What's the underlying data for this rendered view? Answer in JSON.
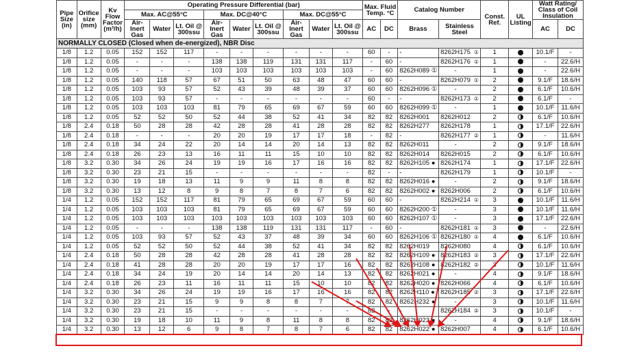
{
  "headers": {
    "pipe_size": "Pipe Size (in)",
    "orifice_size": "Orifice size (mm)",
    "kv_flow": "Kv Flow Factor (m³/h)",
    "opd": "Operating Pressure Differential (bar)",
    "max_ac": "Max. AC@55°C",
    "max_dc40": "Max. DC@40°C",
    "max_dc55": "Max. DC@55°C",
    "air_inert_gas": "Air-Inert Gas",
    "water": "Water",
    "lt_oil": "Lt. Oil @ 300ssu",
    "max_fluid_temp": "Max. Fluid Temp. °C",
    "ac": "AC",
    "dc": "DC",
    "catalog_number": "Catalog Number",
    "brass": "Brass",
    "stainless_steel": "Stainless Steel",
    "const_ref": "Const. Ref.",
    "ul_listing": "UL Listing",
    "watt_rating": "Watt Rating/ Class of Coil Insulation"
  },
  "section_title": "NORMALLY CLOSED (Closed when de-energized), NBR Disc",
  "highlight_color": "#e01818",
  "rows": [
    [
      "1/8",
      "1.2",
      "0.05",
      "152",
      "152",
      "117",
      "-",
      "-",
      "-",
      "-",
      "-",
      "-",
      "60",
      "-",
      "-",
      "8262H175",
      "①",
      "1",
      "full",
      "10.1/F",
      "-"
    ],
    [
      "1/8",
      "1.2",
      "0.05",
      "-",
      "-",
      "-",
      "138",
      "138",
      "119",
      "131",
      "131",
      "117",
      "-",
      "60",
      "-",
      "8262H176",
      "①",
      "1",
      "full",
      "-",
      "22.6/H"
    ],
    [
      "1/8",
      "1.2",
      "0.05",
      "-",
      "-",
      "-",
      "103",
      "103",
      "103",
      "103",
      "103",
      "103",
      "-",
      "60",
      "8262H089 ①",
      "-",
      "",
      "1",
      "full",
      "-",
      "22.6/H"
    ],
    [
      "1/8",
      "1.2",
      "0.05",
      "140",
      "118",
      "57",
      "67",
      "51",
      "50",
      "63",
      "48",
      "47",
      "60",
      "60",
      "-",
      "8262H079",
      "①",
      "2",
      "full",
      "9.1/F",
      "18.6/H"
    ],
    [
      "1/8",
      "1.2",
      "0.05",
      "103",
      "93",
      "57",
      "52",
      "43",
      "39",
      "48",
      "39",
      "37",
      "60",
      "60",
      "8262H096 ①",
      "-",
      "",
      "2",
      "full",
      "6.1/F",
      "10.6/H"
    ],
    [
      "1/8",
      "1.2",
      "0.05",
      "103",
      "93",
      "57",
      "-",
      "-",
      "-",
      "-",
      "-",
      "-",
      "60",
      "-",
      "-",
      "8262H173",
      "①",
      "2",
      "full",
      "6.1/F",
      "-"
    ],
    [
      "1/8",
      "1.2",
      "0.05",
      "103",
      "103",
      "103",
      "81",
      "79",
      "65",
      "69",
      "67",
      "59",
      "60",
      "60",
      "8262H099 ①",
      "-",
      "",
      "1",
      "full",
      "10.1/F",
      "11.6/H"
    ],
    [
      "1/8",
      "1.2",
      "0.05",
      "52",
      "52",
      "50",
      "52",
      "44",
      "38",
      "52",
      "41",
      "34",
      "82",
      "82",
      "8262H001",
      "8262H012",
      "",
      "2",
      "half",
      "6.1/F",
      "10.6/H"
    ],
    [
      "1/8",
      "2.4",
      "0.18",
      "50",
      "28",
      "28",
      "42",
      "28",
      "28",
      "41",
      "28",
      "28",
      "82",
      "82",
      "8262H277",
      "8262H178",
      "",
      "1",
      "half",
      "17.1/F",
      "22.6/H"
    ],
    [
      "1/8",
      "2.4",
      "0.18",
      "-",
      "-",
      "-",
      "20",
      "20",
      "19",
      "17",
      "17",
      "18",
      "-",
      "82",
      "-",
      "8262H177",
      "②",
      "1",
      "half",
      "-",
      "11.6/H"
    ],
    [
      "1/8",
      "2.4",
      "0.18",
      "34",
      "24",
      "22",
      "20",
      "14",
      "14",
      "20",
      "14",
      "13",
      "82",
      "82",
      "8262H011",
      "-",
      "",
      "2",
      "half",
      "9.1/F",
      "18.6/H"
    ],
    [
      "1/8",
      "2.4",
      "0.18",
      "26",
      "23",
      "13",
      "16",
      "11",
      "11",
      "15",
      "10",
      "10",
      "82",
      "82",
      "8262H014",
      "8262H015",
      "",
      "2",
      "half",
      "6.1/F",
      "10.6/H"
    ],
    [
      "1/8",
      "3.2",
      "0.30",
      "34",
      "26",
      "24",
      "19",
      "19",
      "16",
      "17",
      "16",
      "16",
      "82",
      "82",
      "8262H105 ●",
      "8262H174",
      "",
      "1",
      "half",
      "17.1/F",
      "22.6/H"
    ],
    [
      "1/8",
      "3.2",
      "0.30",
      "23",
      "21",
      "15",
      "-",
      "-",
      "-",
      "-",
      "-",
      "-",
      "82",
      "-",
      "-",
      "8262H179",
      "",
      "1",
      "half",
      "10.1/F",
      "-"
    ],
    [
      "1/8",
      "3.2",
      "0.30",
      "19",
      "18",
      "13",
      "11",
      "9",
      "9",
      "11",
      "8",
      "8",
      "82",
      "82",
      "8262H016 ●",
      "-",
      "",
      "2",
      "half",
      "9.1/F",
      "18.6/H"
    ],
    [
      "1/8",
      "3.2",
      "0.30",
      "13",
      "12",
      "8",
      "9",
      "8",
      "7",
      "8",
      "7",
      "6",
      "82",
      "82",
      "8262H002 ●",
      "8262H006",
      "",
      "2",
      "half",
      "6.1/F",
      "10.6/H"
    ],
    [
      "1/4",
      "1.2",
      "0.05",
      "152",
      "152",
      "117",
      "81",
      "79",
      "65",
      "69",
      "67",
      "59",
      "60",
      "60",
      "-",
      "8262H214",
      "①",
      "3",
      "full",
      "10.1/F",
      "11.6/H"
    ],
    [
      "1/4",
      "1.2",
      "0.05",
      "103",
      "103",
      "103",
      "81",
      "79",
      "65",
      "69",
      "67",
      "59",
      "60",
      "60",
      "8262H200 ①",
      "-",
      "",
      "3",
      "full",
      "10.1/F",
      "11.6/H"
    ],
    [
      "1/4",
      "1.2",
      "0.05",
      "103",
      "103",
      "103",
      "103",
      "103",
      "103",
      "103",
      "103",
      "103",
      "60",
      "60",
      "8262H107 ①",
      "-",
      "",
      "3",
      "full",
      "17.1/F",
      "22.6/H"
    ],
    [
      "1/4",
      "1.2",
      "0.05",
      "-",
      "-",
      "-",
      "138",
      "138",
      "119",
      "131",
      "131",
      "117",
      "-",
      "60",
      "-",
      "8262H181",
      "①",
      "3",
      "full",
      "-",
      "22.6/H"
    ],
    [
      "1/4",
      "1.2",
      "0.05",
      "103",
      "93",
      "57",
      "52",
      "43",
      "37",
      "48",
      "39",
      "34",
      "60",
      "60",
      "8262H106 ①",
      "8262H180",
      "①",
      "4",
      "full",
      "6.1/F",
      "10.6/H"
    ],
    [
      "1/4",
      "1.2",
      "0.05",
      "52",
      "52",
      "50",
      "52",
      "44",
      "38",
      "52",
      "41",
      "34",
      "82",
      "82",
      "8262H019",
      "8262H080",
      "",
      "4",
      "half",
      "6.1/F",
      "10.6/H"
    ],
    [
      "1/4",
      "2.4",
      "0.18",
      "50",
      "28",
      "28",
      "42",
      "28",
      "28",
      "41",
      "28",
      "28",
      "82",
      "82",
      "8262H109 ●",
      "8262H183",
      "②",
      "3",
      "half",
      "17.1/F",
      "22.6/H"
    ],
    [
      "1/4",
      "2.4",
      "0.18",
      "41",
      "28",
      "28",
      "20",
      "20",
      "19",
      "17",
      "17",
      "16",
      "82",
      "82",
      "8262H108 ●",
      "8262H182",
      "②",
      "3",
      "half",
      "10.1/F",
      "11.6/H"
    ],
    [
      "1/4",
      "2.4",
      "0.18",
      "34",
      "24",
      "19",
      "20",
      "14",
      "14",
      "20",
      "14",
      "13",
      "82",
      "82",
      "8262H021 ●",
      "-",
      "",
      "4",
      "half",
      "9.1/F",
      "18.6/H"
    ],
    [
      "1/4",
      "2.4",
      "0.18",
      "26",
      "23",
      "11",
      "16",
      "11",
      "11",
      "15",
      "10",
      "10",
      "82",
      "82",
      "8262H020 ●",
      "8262H066",
      "",
      "4",
      "half",
      "6.1/F",
      "10.6/H"
    ],
    [
      "1/4",
      "3.2",
      "0.30",
      "34",
      "26",
      "24",
      "19",
      "19",
      "16",
      "17",
      "16",
      "16",
      "82",
      "82",
      "8262H110 ●",
      "8262H185",
      "②",
      "3",
      "half",
      "17.1/F",
      "22.6/H"
    ],
    [
      "1/4",
      "3.2",
      "0.30",
      "23",
      "21",
      "15",
      "9",
      "9",
      "8",
      "8",
      "7",
      "7",
      "82",
      "82",
      "8262H232 ●",
      "-",
      "",
      "3",
      "half",
      "10.1/F",
      "11.6/H"
    ],
    [
      "1/4",
      "3.2",
      "0.30",
      "23",
      "21",
      "15",
      "-",
      "-",
      "-",
      "-",
      "-",
      "-",
      "82",
      "-",
      "-",
      "8262H184",
      "②",
      "3",
      "half",
      "10.1/F",
      "-"
    ],
    [
      "1/4",
      "3.2",
      "0.30",
      "19",
      "18",
      "10",
      "11",
      "9",
      "8",
      "11",
      "8",
      "8",
      "82",
      "82",
      "8262H023 ●",
      "-",
      "",
      "4",
      "half",
      "9.1/F",
      "18.6/H"
    ],
    [
      "1/4",
      "3.2",
      "0.30",
      "13",
      "12",
      "6",
      "9",
      "8",
      "7",
      "8",
      "7",
      "6",
      "82",
      "82",
      "8262H022 ●",
      "8262H007",
      "",
      "4",
      "half",
      "6.1/F",
      "10.6/H"
    ]
  ]
}
